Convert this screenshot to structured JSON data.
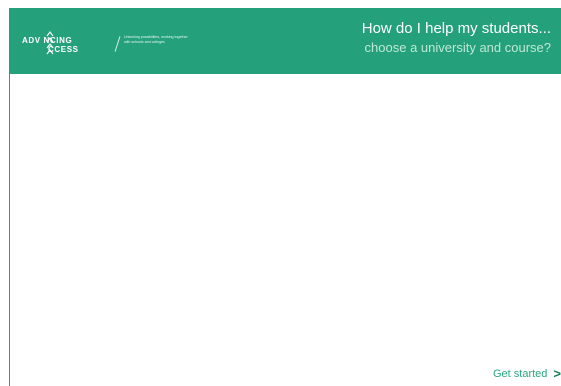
{
  "header": {
    "logo": {
      "line1": "ADV NCING",
      "line2": "CCESS",
      "tagline": "Unlocking possibilities, working together with schools and colleges"
    },
    "title": "How do I help my students...",
    "subtitle": "choose a university and course?"
  },
  "footer": {
    "get_started_label": "Get started",
    "get_started_icon": "chevron-right-icon"
  },
  "colors": {
    "brand_green": "#24a07a",
    "link_green": "#2aa880",
    "subtitle_tint": "#bfe8d6"
  }
}
